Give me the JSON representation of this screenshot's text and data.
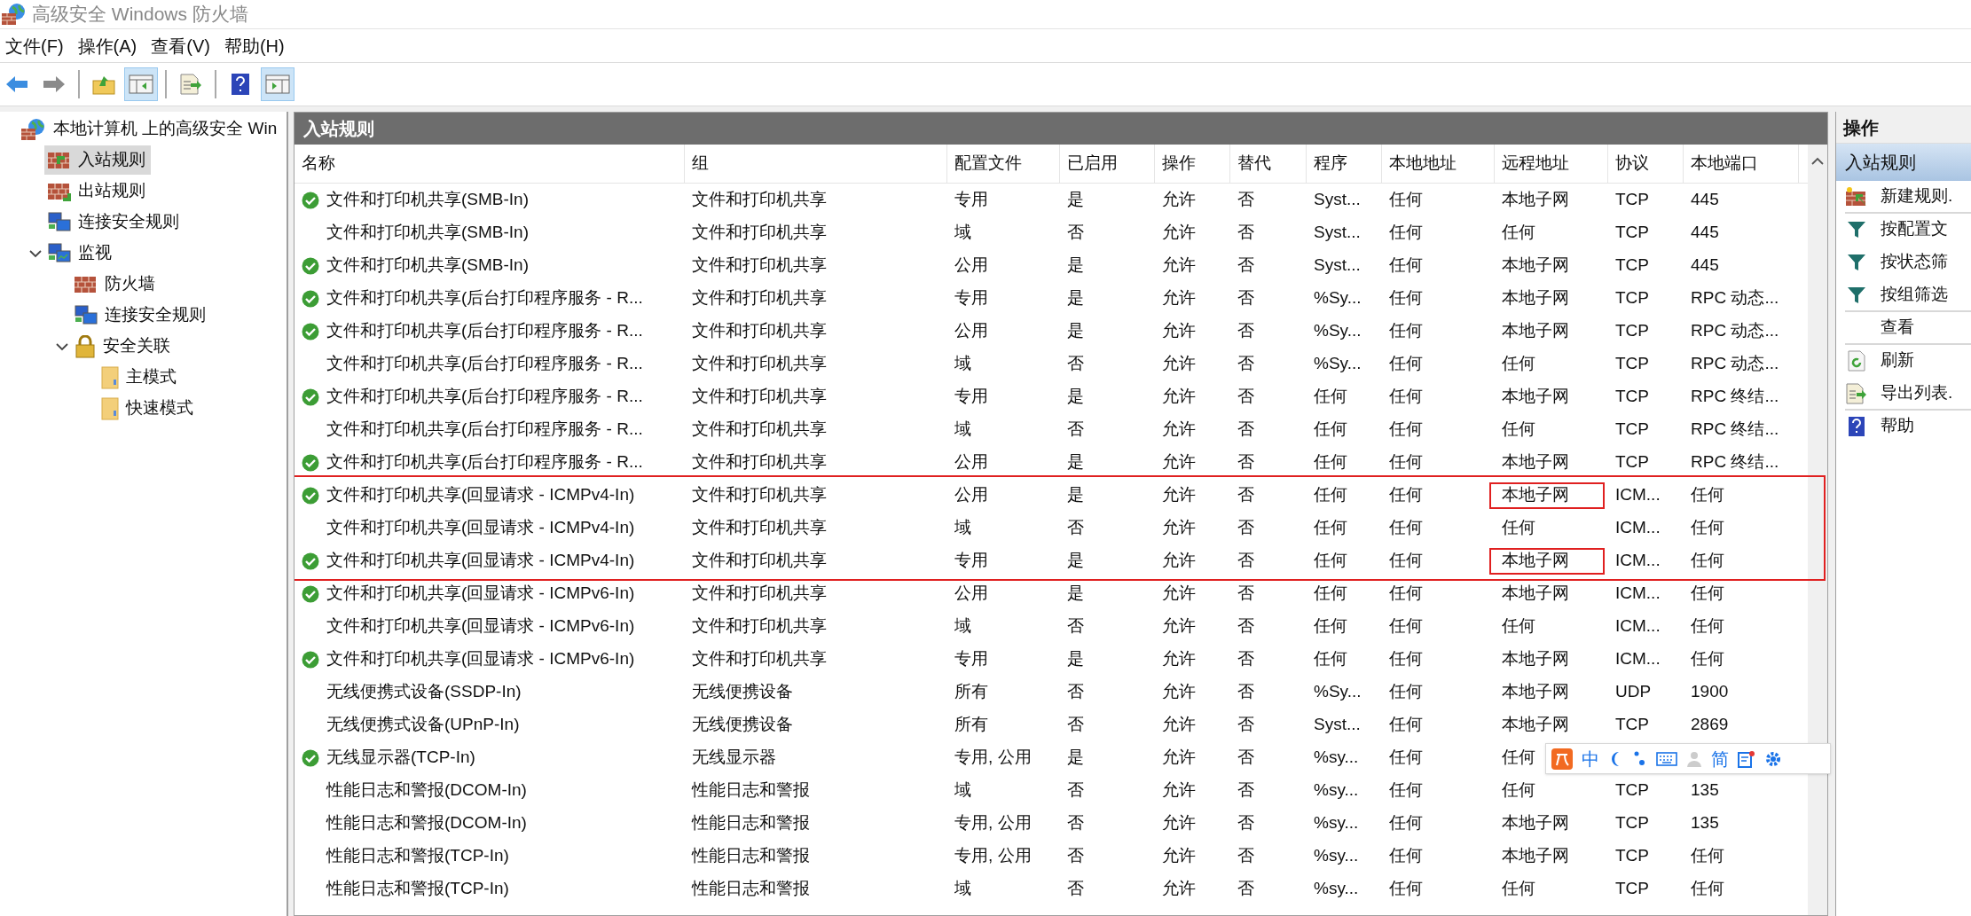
{
  "window": {
    "title": "高级安全 Windows 防火墙"
  },
  "menu": [
    "文件(F)",
    "操作(A)",
    "查看(V)",
    "帮助(H)"
  ],
  "toolbar": [
    [
      {
        "kind": "back",
        "pressed": false
      },
      {
        "kind": "forward",
        "pressed": false
      }
    ],
    [
      {
        "kind": "up",
        "pressed": false
      },
      {
        "kind": "tree-toggle",
        "pressed": true
      }
    ],
    [
      {
        "kind": "export",
        "pressed": false
      }
    ],
    [
      {
        "kind": "help",
        "pressed": false
      },
      {
        "kind": "pane-toggle",
        "pressed": true
      }
    ]
  ],
  "tree": [
    {
      "label": "本地计算机 上的高级安全 Win",
      "kind": "root",
      "selected": false,
      "children": [
        {
          "label": "入站规则",
          "kind": "inbound",
          "selected": true
        },
        {
          "label": "出站规则",
          "kind": "outbound",
          "selected": false
        },
        {
          "label": "连接安全规则",
          "kind": "connection",
          "selected": false
        },
        {
          "label": "监视",
          "kind": "monitor",
          "selected": false,
          "expanded": true,
          "children": [
            {
              "label": "防火墙",
              "kind": "firewall",
              "selected": false
            },
            {
              "label": "连接安全规则",
              "kind": "connection",
              "selected": false
            },
            {
              "label": "安全关联",
              "kind": "lock",
              "selected": false,
              "expanded": true,
              "children": [
                {
                  "label": "主模式",
                  "kind": "folder",
                  "selected": false
                },
                {
                  "label": "快速模式",
                  "kind": "folder",
                  "selected": false
                }
              ]
            }
          ]
        }
      ]
    }
  ],
  "table": {
    "title": "入站规则",
    "columns": [
      "名称",
      "组",
      "配置文件",
      "已启用",
      "操作",
      "替代",
      "程序",
      "本地地址",
      "远程地址",
      "协议",
      "本地端口"
    ],
    "rows": [
      {
        "name": "文件和打印机共享(SMB-In)",
        "group": "文件和打印机共享",
        "profile": "专用",
        "enabled": "是",
        "action": "允许",
        "override": "否",
        "program": "Syst...",
        "local_address": "任何",
        "remote_address": "本地子网",
        "protocol": "TCP",
        "local_port": "445",
        "active": true,
        "marked": false,
        "remote_boxed": false
      },
      {
        "name": "文件和打印机共享(SMB-In)",
        "group": "文件和打印机共享",
        "profile": "域",
        "enabled": "否",
        "action": "允许",
        "override": "否",
        "program": "Syst...",
        "local_address": "任何",
        "remote_address": "任何",
        "protocol": "TCP",
        "local_port": "445",
        "active": false,
        "marked": false,
        "remote_boxed": false
      },
      {
        "name": "文件和打印机共享(SMB-In)",
        "group": "文件和打印机共享",
        "profile": "公用",
        "enabled": "是",
        "action": "允许",
        "override": "否",
        "program": "Syst...",
        "local_address": "任何",
        "remote_address": "本地子网",
        "protocol": "TCP",
        "local_port": "445",
        "active": true,
        "marked": false,
        "remote_boxed": false
      },
      {
        "name": "文件和打印机共享(后台打印程序服务 - R...",
        "group": "文件和打印机共享",
        "profile": "专用",
        "enabled": "是",
        "action": "允许",
        "override": "否",
        "program": "%Sy...",
        "local_address": "任何",
        "remote_address": "本地子网",
        "protocol": "TCP",
        "local_port": "RPC 动态...",
        "active": true,
        "marked": false,
        "remote_boxed": false
      },
      {
        "name": "文件和打印机共享(后台打印程序服务 - R...",
        "group": "文件和打印机共享",
        "profile": "公用",
        "enabled": "是",
        "action": "允许",
        "override": "否",
        "program": "%Sy...",
        "local_address": "任何",
        "remote_address": "本地子网",
        "protocol": "TCP",
        "local_port": "RPC 动态...",
        "active": true,
        "marked": false,
        "remote_boxed": false
      },
      {
        "name": "文件和打印机共享(后台打印程序服务 - R...",
        "group": "文件和打印机共享",
        "profile": "域",
        "enabled": "否",
        "action": "允许",
        "override": "否",
        "program": "%Sy...",
        "local_address": "任何",
        "remote_address": "任何",
        "protocol": "TCP",
        "local_port": "RPC 动态...",
        "active": false,
        "marked": false,
        "remote_boxed": false
      },
      {
        "name": "文件和打印机共享(后台打印程序服务 - R...",
        "group": "文件和打印机共享",
        "profile": "专用",
        "enabled": "是",
        "action": "允许",
        "override": "否",
        "program": "任何",
        "local_address": "任何",
        "remote_address": "本地子网",
        "protocol": "TCP",
        "local_port": "RPC 终结...",
        "active": true,
        "marked": false,
        "remote_boxed": false
      },
      {
        "name": "文件和打印机共享(后台打印程序服务 - R...",
        "group": "文件和打印机共享",
        "profile": "域",
        "enabled": "否",
        "action": "允许",
        "override": "否",
        "program": "任何",
        "local_address": "任何",
        "remote_address": "任何",
        "protocol": "TCP",
        "local_port": "RPC 终结...",
        "active": false,
        "marked": false,
        "remote_boxed": false
      },
      {
        "name": "文件和打印机共享(后台打印程序服务 - R...",
        "group": "文件和打印机共享",
        "profile": "公用",
        "enabled": "是",
        "action": "允许",
        "override": "否",
        "program": "任何",
        "local_address": "任何",
        "remote_address": "本地子网",
        "protocol": "TCP",
        "local_port": "RPC 终结...",
        "active": true,
        "marked": false,
        "remote_boxed": false
      },
      {
        "name": "文件和打印机共享(回显请求 - ICMPv4-In)",
        "group": "文件和打印机共享",
        "profile": "公用",
        "enabled": "是",
        "action": "允许",
        "override": "否",
        "program": "任何",
        "local_address": "任何",
        "remote_address": "本地子网",
        "protocol": "ICM...",
        "local_port": "任何",
        "active": true,
        "marked": true,
        "remote_boxed": true
      },
      {
        "name": "文件和打印机共享(回显请求 - ICMPv4-In)",
        "group": "文件和打印机共享",
        "profile": "域",
        "enabled": "否",
        "action": "允许",
        "override": "否",
        "program": "任何",
        "local_address": "任何",
        "remote_address": "任何",
        "protocol": "ICM...",
        "local_port": "任何",
        "active": false,
        "marked": true,
        "remote_boxed": false
      },
      {
        "name": "文件和打印机共享(回显请求 - ICMPv4-In)",
        "group": "文件和打印机共享",
        "profile": "专用",
        "enabled": "是",
        "action": "允许",
        "override": "否",
        "program": "任何",
        "local_address": "任何",
        "remote_address": "本地子网",
        "protocol": "ICM...",
        "local_port": "任何",
        "active": true,
        "marked": true,
        "remote_boxed": true
      },
      {
        "name": "文件和打印机共享(回显请求 - ICMPv6-In)",
        "group": "文件和打印机共享",
        "profile": "公用",
        "enabled": "是",
        "action": "允许",
        "override": "否",
        "program": "任何",
        "local_address": "任何",
        "remote_address": "本地子网",
        "protocol": "ICM...",
        "local_port": "任何",
        "active": true,
        "marked": false,
        "remote_boxed": false
      },
      {
        "name": "文件和打印机共享(回显请求 - ICMPv6-In)",
        "group": "文件和打印机共享",
        "profile": "域",
        "enabled": "否",
        "action": "允许",
        "override": "否",
        "program": "任何",
        "local_address": "任何",
        "remote_address": "任何",
        "protocol": "ICM...",
        "local_port": "任何",
        "active": false,
        "marked": false,
        "remote_boxed": false
      },
      {
        "name": "文件和打印机共享(回显请求 - ICMPv6-In)",
        "group": "文件和打印机共享",
        "profile": "专用",
        "enabled": "是",
        "action": "允许",
        "override": "否",
        "program": "任何",
        "local_address": "任何",
        "remote_address": "本地子网",
        "protocol": "ICM...",
        "local_port": "任何",
        "active": true,
        "marked": false,
        "remote_boxed": false
      },
      {
        "name": "无线便携式设备(SSDP-In)",
        "group": "无线便携设备",
        "profile": "所有",
        "enabled": "否",
        "action": "允许",
        "override": "否",
        "program": "%Sy...",
        "local_address": "任何",
        "remote_address": "本地子网",
        "protocol": "UDP",
        "local_port": "1900",
        "active": false,
        "marked": false,
        "remote_boxed": false
      },
      {
        "name": "无线便携式设备(UPnP-In)",
        "group": "无线便携设备",
        "profile": "所有",
        "enabled": "否",
        "action": "允许",
        "override": "否",
        "program": "Syst...",
        "local_address": "任何",
        "remote_address": "本地子网",
        "protocol": "TCP",
        "local_port": "2869",
        "active": false,
        "marked": false,
        "remote_boxed": false
      },
      {
        "name": "无线显示器(TCP-In)",
        "group": "无线显示器",
        "profile": "专用, 公用",
        "enabled": "是",
        "action": "允许",
        "override": "否",
        "program": "%sy...",
        "local_address": "任何",
        "remote_address": "任何",
        "active": true,
        "marked": false,
        "remote_boxed": false
      },
      {
        "name": "性能日志和警报(DCOM-In)",
        "group": "性能日志和警报",
        "profile": "域",
        "enabled": "否",
        "action": "允许",
        "override": "否",
        "program": "%sy...",
        "local_address": "任何",
        "remote_address": "任何",
        "protocol": "TCP",
        "local_port": "135",
        "active": false,
        "marked": false,
        "remote_boxed": false
      },
      {
        "name": "性能日志和警报(DCOM-In)",
        "group": "性能日志和警报",
        "profile": "专用, 公用",
        "enabled": "否",
        "action": "允许",
        "override": "否",
        "program": "%sy...",
        "local_address": "任何",
        "remote_address": "本地子网",
        "protocol": "TCP",
        "local_port": "135",
        "active": false,
        "marked": false,
        "remote_boxed": false
      },
      {
        "name": "性能日志和警报(TCP-In)",
        "group": "性能日志和警报",
        "profile": "专用, 公用",
        "enabled": "否",
        "action": "允许",
        "override": "否",
        "program": "%sy...",
        "local_address": "任何",
        "remote_address": "本地子网",
        "protocol": "TCP",
        "local_port": "任何",
        "active": false,
        "marked": false,
        "remote_boxed": false
      },
      {
        "name": "性能日志和警报(TCP-In)",
        "group": "性能日志和警报",
        "profile": "域",
        "enabled": "否",
        "action": "允许",
        "override": "否",
        "program": "%sy...",
        "local_address": "任何",
        "remote_address": "任何",
        "protocol": "TCP",
        "local_port": "任何",
        "active": false,
        "marked": false,
        "remote_boxed": false
      }
    ]
  },
  "actions": {
    "title": "操作",
    "section": "入站规则",
    "items": [
      {
        "label": "新建规则.",
        "kind": "new",
        "separator_after": true
      },
      {
        "label": "按配置文",
        "kind": "filter",
        "separator_after": false
      },
      {
        "label": "按状态筛",
        "kind": "filter",
        "separator_after": false
      },
      {
        "label": "按组筛选",
        "kind": "filter",
        "separator_after": true
      },
      {
        "label": "查看",
        "kind": "none",
        "separator_after": true
      },
      {
        "label": "刷新",
        "kind": "refresh",
        "separator_after": false
      },
      {
        "label": "导出列表.",
        "kind": "export",
        "separator_after": true
      },
      {
        "label": "帮助",
        "kind": "help",
        "separator_after": false
      }
    ]
  },
  "ime_bar": {
    "mode": "中",
    "script": "简"
  }
}
